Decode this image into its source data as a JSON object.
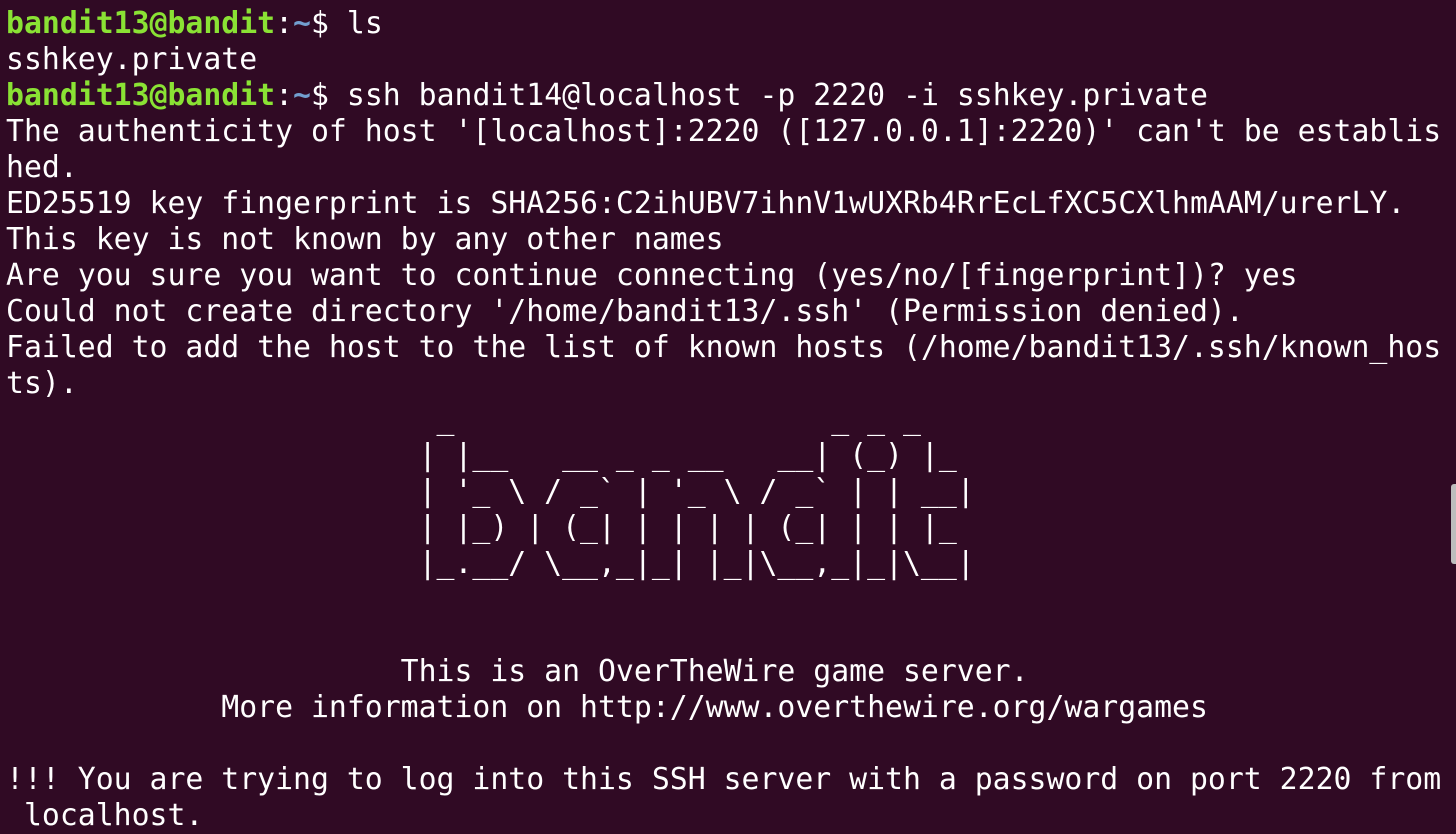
{
  "prompt": {
    "user_host": "bandit13@bandit",
    "separator": ":",
    "path": "~",
    "dollar": "$ "
  },
  "commands": {
    "cmd1": "ls",
    "cmd2": "ssh bandit14@localhost -p 2220 -i sshkey.private"
  },
  "output": {
    "ls_result": "sshkey.private",
    "auth_line1": "The authenticity of host '[localhost]:2220 ([127.0.0.1]:2220)' can't be establis",
    "auth_line2": "hed.",
    "fingerprint": "ED25519 key fingerprint is SHA256:C2ihUBV7ihnV1wUXRb4RrEcLfXC5CXlhmAAM/urerLY.",
    "not_known": "This key is not known by any other names",
    "continue_prompt": "Are you sure you want to continue connecting (yes/no/[fingerprint])? yes",
    "could_not_create": "Could not create directory '/home/bandit13/.ssh' (Permission denied).",
    "failed_add_1": "Failed to add the host to the list of known hosts (/home/bandit13/.ssh/known_hos",
    "failed_add_2": "ts).",
    "ascii_art": "                        _                     _ _ _   \n                       | |__   __ _ _ __   __| (_) |_ \n                       | '_ \\ / _` | '_ \\ / _` | | __|\n                       | |_) | (_| | | | | (_| | | |_ \n                       |_.__/ \\__,_|_| |_|\\__,_|_|\\__|",
    "blank1": "",
    "blank2": "",
    "game_server": "                      This is an OverTheWire game server.",
    "more_info": "            More information on http://www.overthewire.org/wargames",
    "blank3": "",
    "warning_1": "!!! You are trying to log into this SSH server with a password on port 2220 from",
    "warning_2": " localhost."
  }
}
